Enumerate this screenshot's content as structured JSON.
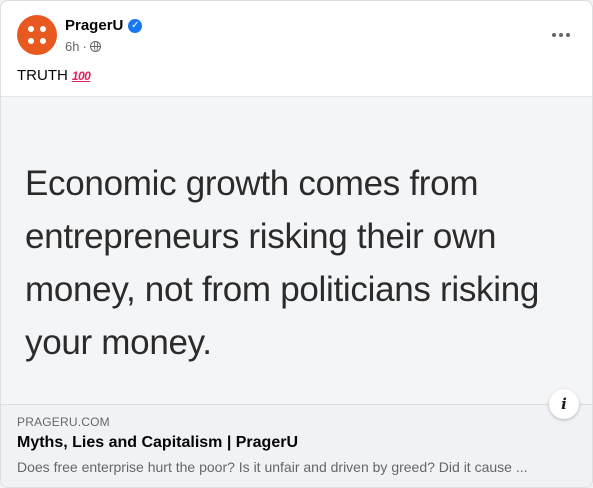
{
  "post": {
    "page_name": "PragerU",
    "verified_icon": "verified-badge-icon",
    "timestamp": "6h",
    "separator": "·",
    "privacy_icon": "globe-icon",
    "more_icon": "more-options-icon",
    "caption": "TRUTH",
    "caption_emoji": "100",
    "caption_emoji_icon": "hundred-points-emoji-icon"
  },
  "image": {
    "quote_lines": [
      "Economic growth comes from",
      "entrepreneurs risking their own",
      "money, not from politicians risking",
      "your money."
    ],
    "info_label": "i"
  },
  "link_preview": {
    "domain": "PRAGERU.COM",
    "title": "Myths, Lies and Capitalism | PragerU",
    "description": "Does free enterprise hurt the poor? Is it unfair and driven by greed? Did it cause ..."
  },
  "colors": {
    "avatar_bg": "#e8591f",
    "verified_blue": "#1877f2",
    "secondary_text": "#65676b",
    "preview_bg": "#f0f2f5"
  }
}
